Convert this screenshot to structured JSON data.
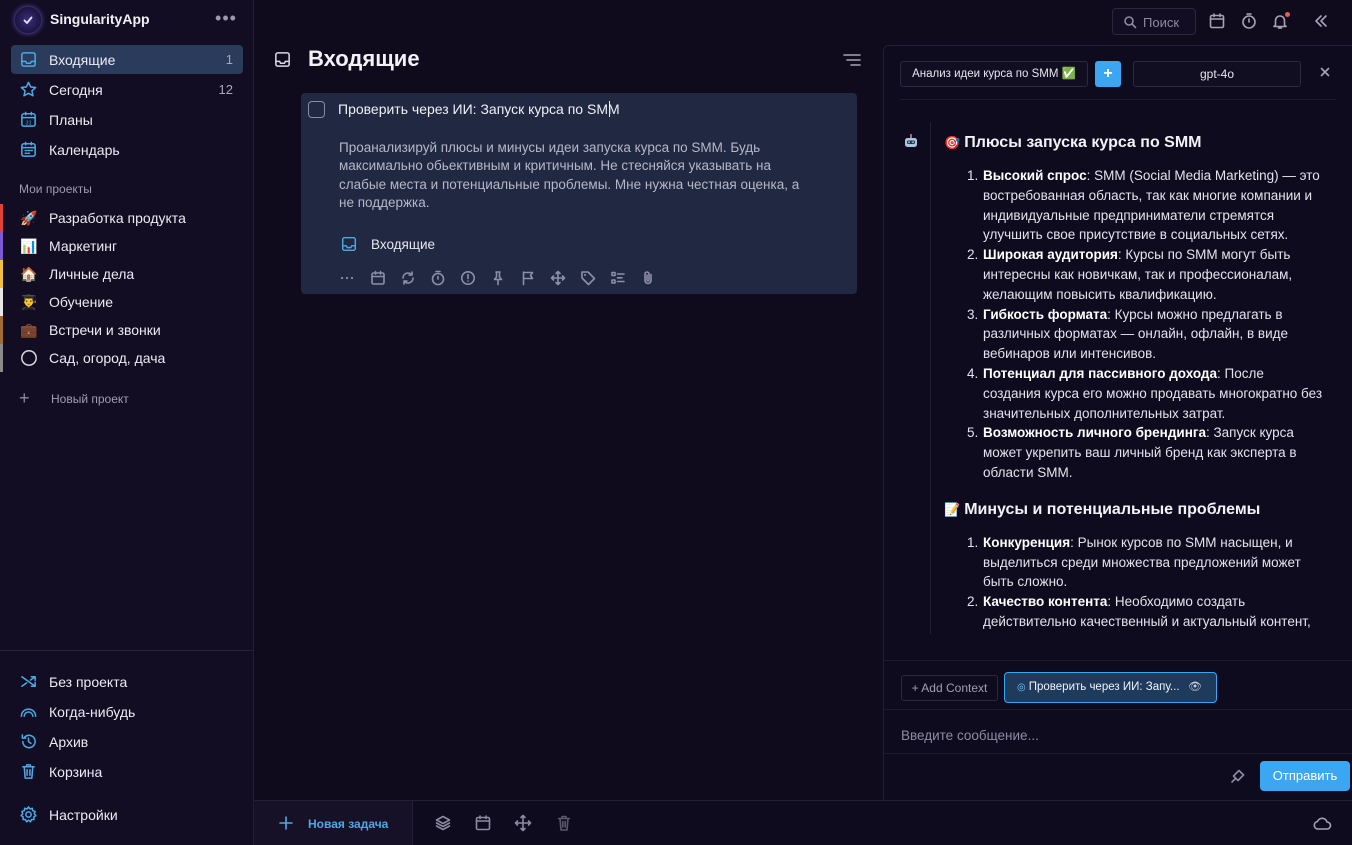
{
  "app": {
    "name": "SingularityApp",
    "menu_label": "•••"
  },
  "sidebar": {
    "nav": [
      {
        "label": "Входящие",
        "count": "1",
        "icon": "inbox-icon",
        "active": true
      },
      {
        "label": "Сегодня",
        "count": "12",
        "icon": "star-icon"
      },
      {
        "label": "Планы",
        "count": "",
        "icon": "calendar-31-icon"
      },
      {
        "label": "Календарь",
        "count": "",
        "icon": "calendar-icon"
      }
    ],
    "projects_title": "Мои проекты",
    "projects": [
      {
        "label": "Разработка продукта",
        "icon": "🚀",
        "color": "#e0413a"
      },
      {
        "label": "Маркетинг",
        "icon": "📊",
        "color": "#7a5ad6"
      },
      {
        "label": "Личные дела",
        "icon": "🏠",
        "color": "#f0c040"
      },
      {
        "label": "Обучение",
        "icon": "👨‍🎓",
        "color": "#e8e8e8"
      },
      {
        "label": "Встречи и звонки",
        "icon": "💼",
        "color": "#a36b2e"
      },
      {
        "label": "Сад, огород, дача",
        "icon": "circle-icon",
        "color": "#8a8a8a"
      }
    ],
    "new_project_label": "Новый проект",
    "bottom": [
      {
        "label": "Без проекта",
        "icon": "shuffle-icon"
      },
      {
        "label": "Когда-нибудь",
        "icon": "rainbow-icon"
      },
      {
        "label": "Архив",
        "icon": "history-icon"
      },
      {
        "label": "Корзина",
        "icon": "trash-icon"
      }
    ],
    "settings_label": "Настройки"
  },
  "toolbar": {
    "search_placeholder": "Поиск"
  },
  "main": {
    "title": "Входящие",
    "task": {
      "title": "Проверить через ИИ: Запуск курса по SMM",
      "description": "Проанализируй плюсы и минусы идеи запуска курса по SMM. Будь максимально обьективным и критичным. Не стесняйся указывать на слабые места и потенциальные проблемы. Мне нужна честная оценка, а не поддержка.",
      "project": "Входящие"
    }
  },
  "ai_panel": {
    "chat_title": "Анализ идеи курса по SMM ✅",
    "add_label": "+",
    "model": "gpt-4o",
    "pros_heading": "Плюсы запуска курса по SMM",
    "pros_emoji": "🎯",
    "pros": [
      {
        "n": "1.",
        "title": "Высокий спрос",
        "text": ": SMM (Social Media Marketing) — это востребованная область, так как многие компании и индивидуальные предприниматели стремятся улучшить свое присутствие в социальных сетях."
      },
      {
        "n": "2.",
        "title": "Широкая аудитория",
        "text": ": Курсы по SMM могут быть интересны как новичкам, так и профессионалам, желающим повысить квалификацию."
      },
      {
        "n": "3.",
        "title": "Гибкость формата",
        "text": ": Курсы можно предлагать в различных форматах — онлайн, офлайн, в виде вебинаров или интенсивов."
      },
      {
        "n": "4.",
        "title": "Потенциал для пассивного дохода",
        "text": ": После создания курса его можно продавать многократно без значительных дополнительных затрат."
      },
      {
        "n": "5.",
        "title": "Возможность личного брендинга",
        "text": ": Запуск курса может укрепить ваш личный бренд как эксперта в области SMM."
      }
    ],
    "cons_heading": "Минусы и потенциальные проблемы",
    "cons_emoji": "📝",
    "cons": [
      {
        "n": "1.",
        "title": "Конкуренция",
        "text": ": Рынок курсов по SMM насыщен, и выделиться среди множества предложений может быть сложно."
      },
      {
        "n": "2.",
        "title": "Качество контента",
        "text": ": Необходимо создать действительно качественный и актуальный контент,"
      }
    ],
    "add_context_label": "+ Add Context",
    "context_chip_label": "Проверить через ИИ: Запу...",
    "input_placeholder": "Введите сообщение...",
    "send_label": "Отправить"
  },
  "bottom_bar": {
    "new_task_label": "Новая задача"
  }
}
